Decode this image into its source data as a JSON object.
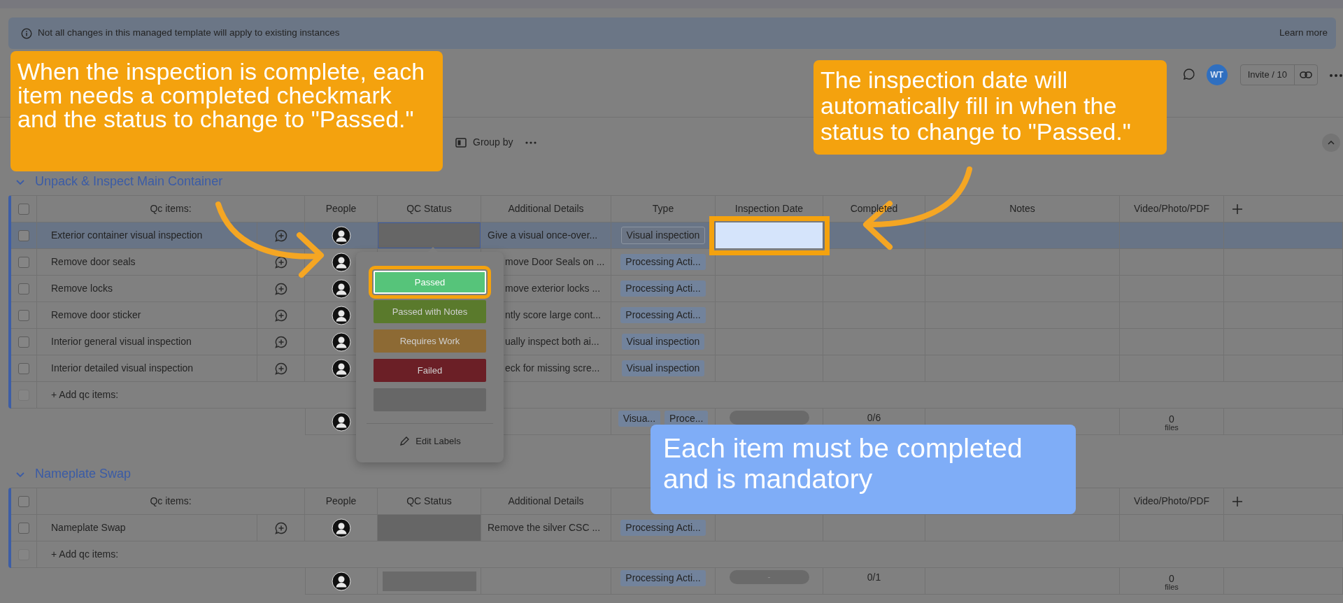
{
  "banner": {
    "text": "Not all changes in this managed template will apply to existing instances",
    "link": "Learn more"
  },
  "header": {
    "user_initials": "WT",
    "invite": "Invite / 10"
  },
  "toolbar": {
    "group_by": "Group by"
  },
  "groups": [
    {
      "title": "Unpack & Inspect Main Container",
      "select_all_checked": false,
      "columns": {
        "items": "Qc items:",
        "people": "People",
        "status": "QC Status",
        "details": "Additional Details",
        "type": "Type",
        "date": "Inspection Date",
        "completed": "Completed",
        "notes": "Notes",
        "files": "Video/Photo/PDF"
      },
      "rows": [
        {
          "name": "Exterior container visual inspection",
          "details": "Give a visual once-over...",
          "type": "Visual inspection",
          "checked": false,
          "selected": true,
          "date_highlighted": true
        },
        {
          "name": "Remove door seals",
          "details": "move Door Seals on ...",
          "type": "Processing Acti...",
          "checked": false,
          "selected": false,
          "date_highlighted": false
        },
        {
          "name": "Remove locks",
          "details": "move exterior locks ...",
          "type": "Processing Acti...",
          "checked": false,
          "selected": false,
          "date_highlighted": false
        },
        {
          "name": "Remove door sticker",
          "details": "ntly score large cont...",
          "type": "Processing Acti...",
          "checked": false,
          "selected": false,
          "date_highlighted": false
        },
        {
          "name": "Interior general visual inspection",
          "details": "ually inspect both ai...",
          "type": "Visual inspection",
          "checked": false,
          "selected": false,
          "date_highlighted": false
        },
        {
          "name": "Interior detailed visual inspection",
          "details": "eck for missing scre...",
          "type": "Visual inspection",
          "checked": false,
          "selected": false,
          "date_highlighted": false
        }
      ],
      "add_row": {
        "label": "+ Add qc items:",
        "checkbox_disabled": true
      },
      "summary": {
        "types": [
          "Visua...",
          "Proce..."
        ],
        "date_pill": true,
        "completed": "0/6",
        "files_count": "0",
        "files_label": "files"
      }
    },
    {
      "title": "Nameplate Swap",
      "select_all_checked": false,
      "columns": {
        "items": "Qc items:",
        "people": "People",
        "status": "QC Status",
        "details": "Additional Details",
        "files": "Video/Photo/PDF"
      },
      "rows": [
        {
          "name": "Nameplate Swap",
          "details": "Remove the silver CSC ...",
          "type": "Processing Acti...",
          "checked": false,
          "selected": false,
          "date_highlighted": false
        }
      ],
      "add_row": {
        "label": "+ Add qc items:",
        "checkbox_disabled": true
      },
      "summary": {
        "status_bar": true,
        "types": [
          "Processing Acti..."
        ],
        "date_pill": true,
        "date_text": "-",
        "completed": "0/1",
        "files_count": "0",
        "files_label": "files"
      }
    }
  ],
  "status_menu": {
    "labels": [
      {
        "text": "Passed",
        "color": "#56c47a",
        "highlighted": true
      },
      {
        "text": "Passed with Notes",
        "color": "#5a7a2c",
        "highlighted": false
      },
      {
        "text": "Requires Work",
        "color": "#8d6a34",
        "highlighted": false
      },
      {
        "text": "Failed",
        "color": "#6b1f26",
        "highlighted": false
      },
      {
        "color": "#676767",
        "highlighted": false
      }
    ],
    "edit": "Edit Labels"
  },
  "callouts": [
    {
      "text": "When the inspection is complete, each item needs a completed checkmark and the status to change to \"Passed.\"",
      "color": "#f4a20e"
    },
    {
      "text": "The inspection date will automatically fill in when the status to change to \"Passed.\"",
      "color": "#f4a20e"
    },
    {
      "text": "Each item must be completed and is mandatory",
      "color": "#7fadf7"
    }
  ]
}
